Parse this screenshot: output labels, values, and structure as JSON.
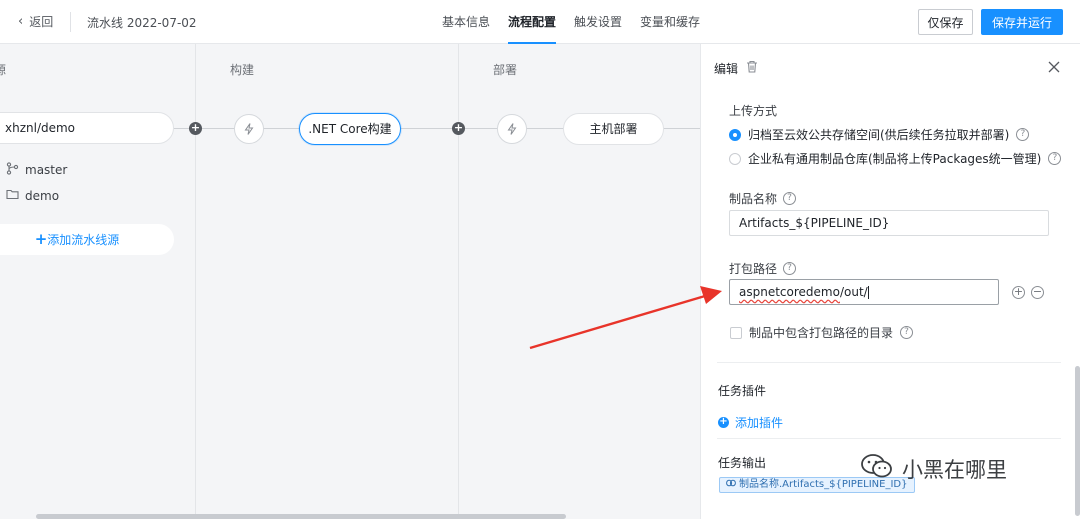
{
  "topbar": {
    "back_label": "返回",
    "pipeline_name": "流水线 2022-07-02",
    "tabs": [
      {
        "label": "基本信息"
      },
      {
        "label": "流程配置"
      },
      {
        "label": "触发设置"
      },
      {
        "label": "变量和缓存"
      }
    ],
    "active_tab": "流程配置",
    "save_only_label": "仅保存",
    "save_run_label": "保存并运行"
  },
  "canvas": {
    "stages": [
      {
        "title": "源"
      },
      {
        "title": "构建"
      },
      {
        "title": "部署"
      }
    ],
    "source": {
      "repo": "xhznl/demo",
      "branch": "master",
      "folder": "demo",
      "add_label": "添加流水线源"
    },
    "build_node": ".NET Core构建",
    "deploy_node": "主机部署"
  },
  "panel": {
    "title": "编辑",
    "upload_method_label": "上传方式",
    "upload_options": [
      {
        "label": "归档至云效公共存储空间(供后续任务拉取并部署)",
        "selected": true
      },
      {
        "label": "企业私有通用制品仓库(制品将上传Packages统一管理)",
        "selected": false
      }
    ],
    "artifact_name_label": "制品名称",
    "artifact_name_value": "Artifacts_${PIPELINE_ID}",
    "pack_path_label": "打包路径",
    "pack_path_value_a": "aspnetcoredemo",
    "pack_path_value_b": "/out/",
    "include_dir_label": "制品中包含打包路径的目录",
    "plugins_title": "任务插件",
    "add_plugin_label": "添加插件",
    "output_title": "任务输出",
    "output_tag": "制品名称.Artifacts_${PIPELINE_ID}"
  },
  "watermark": "小黑在哪里",
  "colors": {
    "accent": "#1890ff",
    "arrow": "#e8342a"
  },
  "icons": {
    "back": "chevron-left-icon",
    "trash": "trash-icon",
    "close": "close-icon",
    "help": "question-circle-icon",
    "trigger": "lightning-icon",
    "branch": "branch-icon",
    "folder": "folder-icon"
  }
}
